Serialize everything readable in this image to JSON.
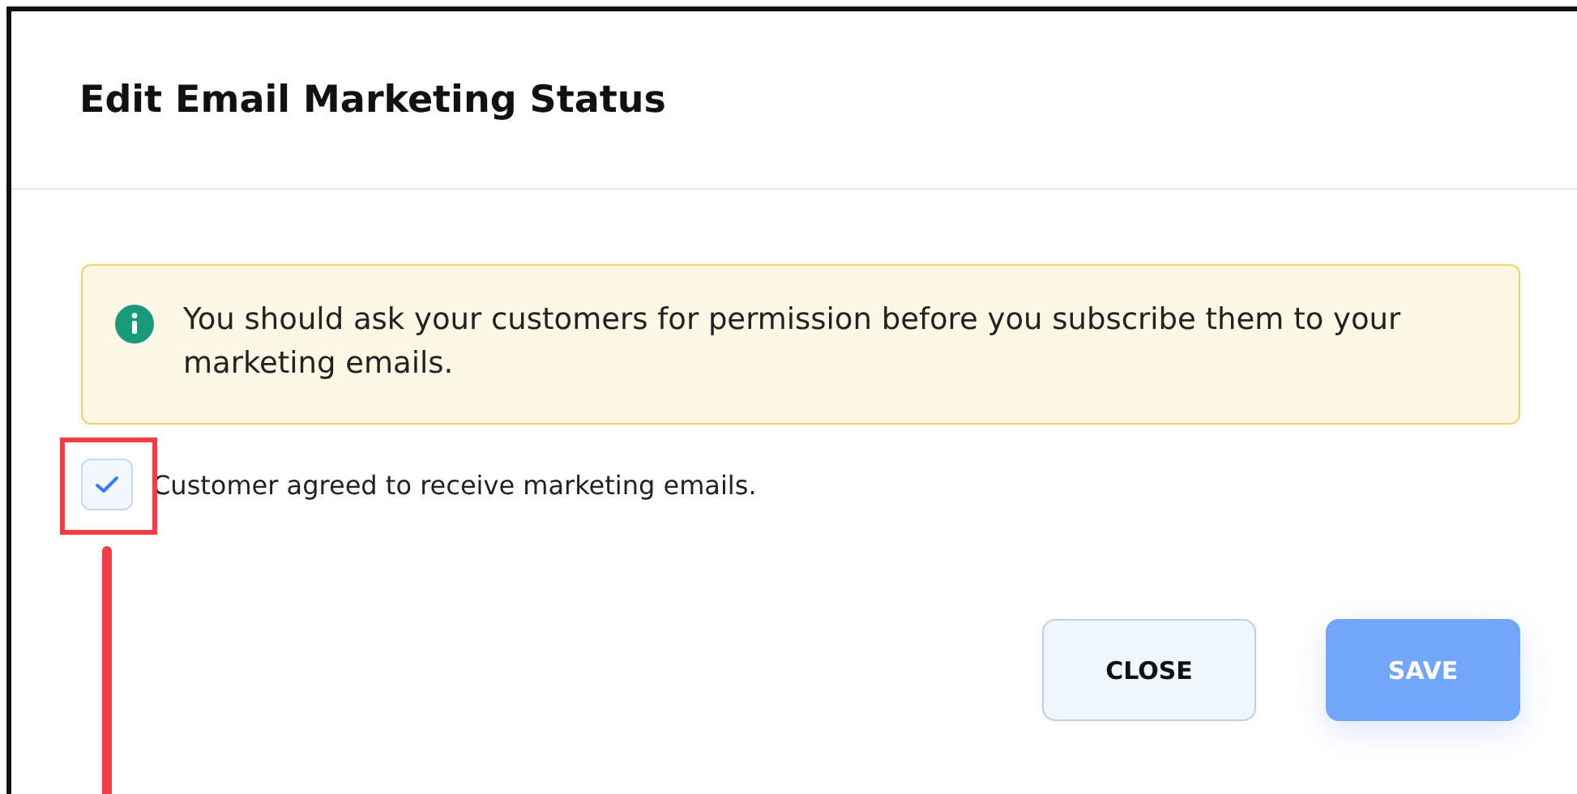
{
  "dialog": {
    "title": "Edit Email Marketing Status"
  },
  "notice": {
    "text": "You should ask your customers for permission before you subscribe them to your marketing emails."
  },
  "consent": {
    "label": "Customer agreed to receive marketing emails.",
    "checked": true
  },
  "buttons": [
    {
      "label": "CLOSE",
      "kind": "secondary",
      "disabled": false
    },
    {
      "label": "SAVE",
      "kind": "primary",
      "disabled": true
    }
  ]
}
